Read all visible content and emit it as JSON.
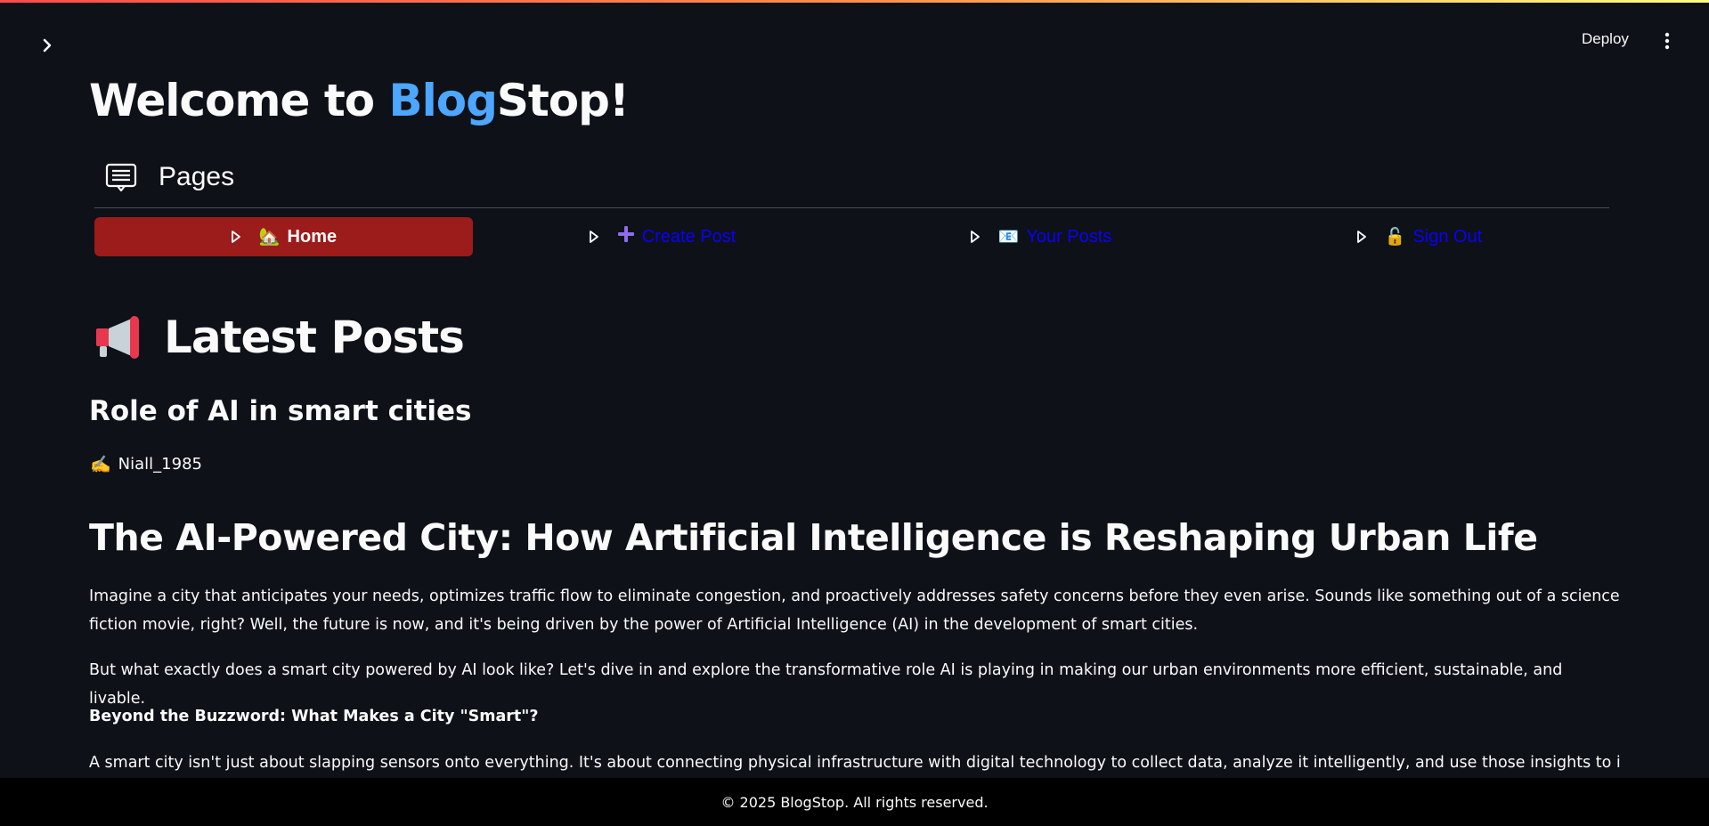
{
  "header": {
    "deploy_label": "Deploy",
    "sidebar_toggle_icon": "chevron-right-icon",
    "menu_icon": "kebab-menu-icon"
  },
  "title": {
    "prefix": "Welcome to ",
    "accent": "Blog",
    "suffix": "Stop!",
    "accent_color": "#4da6ff"
  },
  "pages": {
    "label": "Pages",
    "icon": "page-list-icon"
  },
  "nav": {
    "items": [
      {
        "emoji": "🏡",
        "label": "Home",
        "active": true
      },
      {
        "emoji": "➕",
        "label": "Create Post",
        "active": false
      },
      {
        "emoji": "📧",
        "label": "Your Posts",
        "active": false
      },
      {
        "emoji": "🔓",
        "label": "Sign Out",
        "active": false
      }
    ],
    "active_color": "#9c1b1b",
    "link_color": "#0a00ff"
  },
  "latest": {
    "emoji": "📢",
    "title": "Latest Posts"
  },
  "post": {
    "title": "Role of AI in smart cities",
    "author_emoji": "✍️",
    "author": "Niall_1985",
    "heading": "The AI-Powered City: How Artificial Intelligence is Reshaping Urban Life",
    "paragraphs": [
      "Imagine a city that anticipates your needs, optimizes traffic flow to eliminate congestion, and proactively addresses safety concerns before they even arise. Sounds like something out of a science fiction movie, right? Well, the future is now, and it's being driven by the power of Artificial Intelligence (AI) in the development of smart cities.",
      "But what exactly does a smart city powered by AI look like? Let's dive in and explore the transformative role AI is playing in making our urban environments more efficient, sustainable, and livable.",
      "Beyond the Buzzword: What Makes a City \"Smart\"?",
      "A smart city isn't just about slapping sensors onto everything. It's about connecting physical infrastructure with digital technology to collect data, analyze it intelligently, and use those insights to improve city"
    ]
  },
  "footer": {
    "text": "© 2025 BlogStop. All rights reserved."
  }
}
